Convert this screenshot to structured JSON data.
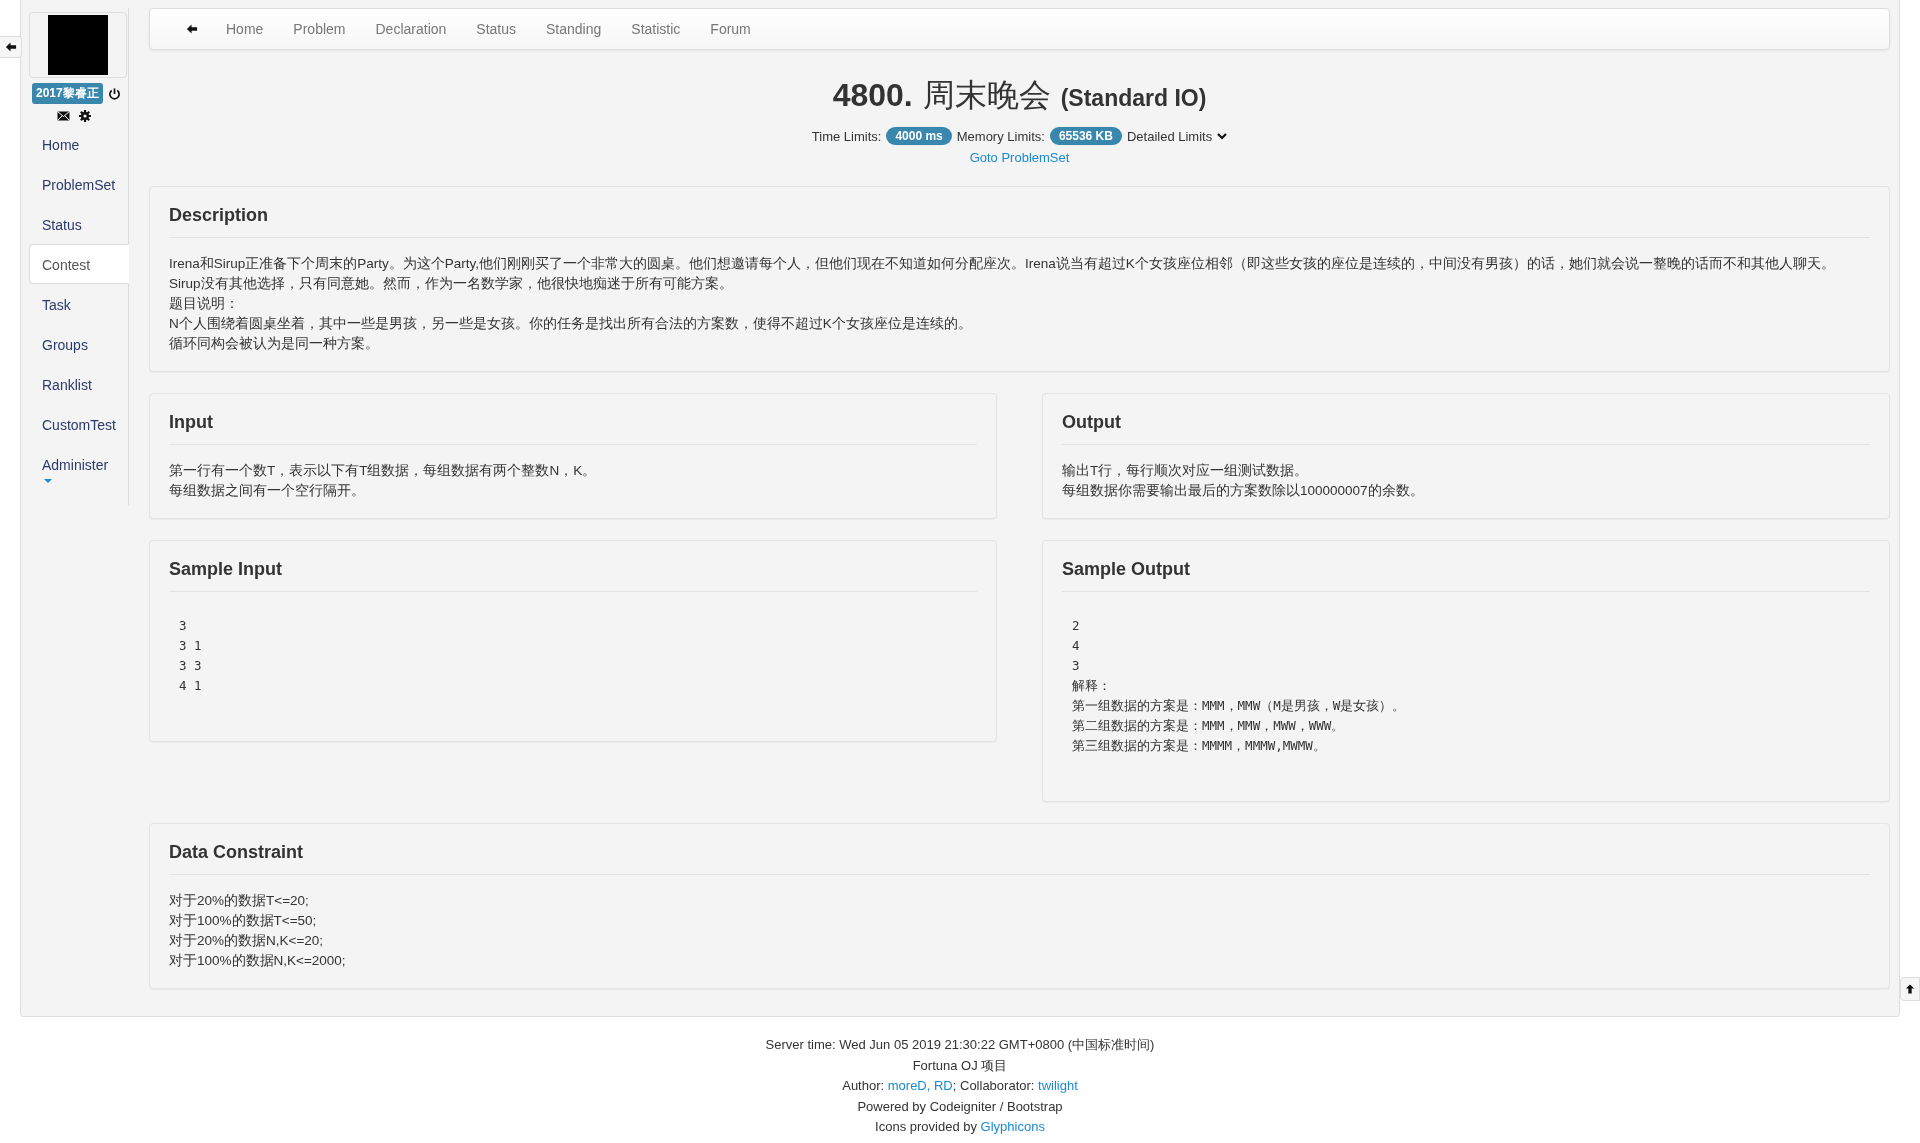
{
  "sidebar": {
    "user_badge": "2017黎睿正",
    "items": [
      {
        "label": "Home",
        "selected": false
      },
      {
        "label": "ProblemSet",
        "selected": false
      },
      {
        "label": "Status",
        "selected": false
      },
      {
        "label": "Contest",
        "selected": true
      },
      {
        "label": "Task",
        "selected": false
      },
      {
        "label": "Groups",
        "selected": false
      },
      {
        "label": "Ranklist",
        "selected": false
      },
      {
        "label": "CustomTest",
        "selected": false
      },
      {
        "label": "Administer",
        "selected": false,
        "has_menu": true
      }
    ]
  },
  "navbar": {
    "items": [
      "Home",
      "Problem",
      "Declaration",
      "Status",
      "Standing",
      "Statistic",
      "Forum"
    ]
  },
  "problem": {
    "number": "4800.",
    "title": "周末晚会",
    "io": "(Standard IO)",
    "time_limits_label": "Time Limits:",
    "time_limit": "4000 ms",
    "memory_limits_label": "Memory Limits:",
    "memory_limit": "65536 KB",
    "detailed_limits": "Detailed Limits",
    "goto": "Goto ProblemSet"
  },
  "rows": [
    [
      {
        "kind": "text",
        "title": "Description",
        "lines": [
          "Irena和Sirup正准备下个周末的Party。为这个Party,他们刚刚买了一个非常大的圆桌。他们想邀请每个人，但他们现在不知道如何分配座次。Irena说当有超过K个女孩座位相邻（即这些女孩的座位是连续的，中间没有男孩）的话，她们就会说一整晚的话而不和其他人聊天。",
          "Sirup没有其他选择，只有同意她。然而，作为一名数学家，他很快地痴迷于所有可能方案。",
          "题目说明：",
          "N个人围绕着圆桌坐着，其中一些是男孩，另一些是女孩。你的任务是找出所有合法的方案数，使得不超过K个女孩座位是连续的。",
          "循环同构会被认为是同一种方案。"
        ]
      }
    ],
    [
      {
        "kind": "text",
        "title": "Input",
        "lines": [
          "第一行有一个数T，表示以下有T组数据，每组数据有两个整数N，K。",
          "每组数据之间有一个空行隔开。"
        ]
      },
      {
        "kind": "text",
        "title": "Output",
        "lines": [
          "输出T行，每行顺次对应一组测试数据。",
          "每组数据你需要输出最后的方案数除以100000007的余数。"
        ]
      }
    ],
    [
      {
        "kind": "code",
        "title": "Sample Input",
        "lines": [
          "3",
          "3 1",
          "3 3",
          "4 1"
        ]
      },
      {
        "kind": "code",
        "title": "Sample Output",
        "lines": [
          "2",
          "4",
          "3",
          "解释：",
          "第一组数据的方案是：MMM，MMW（M是男孩，W是女孩）。",
          "第二组数据的方案是：MMM，MMW，MWW，WWW。",
          "第三组数据的方案是：MMMM，MMMW,MWMW。"
        ]
      }
    ],
    [
      {
        "kind": "text",
        "title": "Data Constraint",
        "lines": [
          "对于20%的数据T<=20;",
          "对于100%的数据T<=50;",
          "对于20%的数据N,K<=20;",
          "对于100%的数据N,K<=2000;"
        ]
      }
    ]
  ],
  "footer": {
    "lines": [
      [
        {
          "text": "Server time: Wed Jun 05 2019 21:30:22 GMT+0800 (中国标准时间)",
          "link": false
        }
      ],
      [
        {
          "text": "Fortuna OJ 项目",
          "link": false
        }
      ],
      [
        {
          "text": "Author: ",
          "link": false
        },
        {
          "text": "moreD, RD",
          "link": true
        },
        {
          "text": "; Collaborator: ",
          "link": false
        },
        {
          "text": "twilight",
          "link": true
        }
      ],
      [
        {
          "text": "Powered by Codeigniter / Bootstrap",
          "link": false
        }
      ],
      [
        {
          "text": "Icons provided by ",
          "link": false
        },
        {
          "text": "Glyphicons",
          "link": true
        }
      ]
    ]
  }
}
